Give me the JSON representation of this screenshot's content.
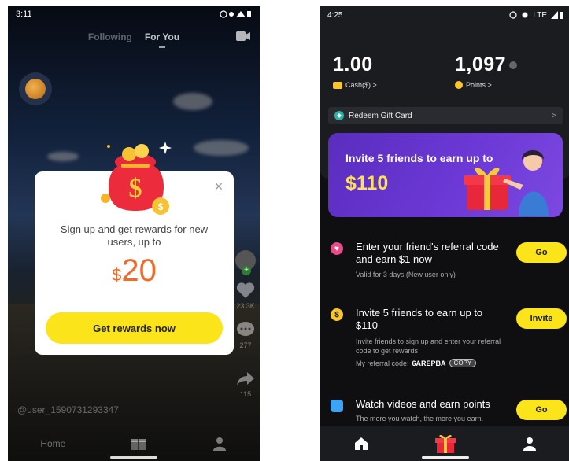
{
  "left": {
    "status": {
      "time": "3:11"
    },
    "tabs": {
      "following": "Following",
      "for_you": "For You"
    },
    "modal": {
      "text": "Sign up and get rewards for new users, up to",
      "currency": "$",
      "amount": "20",
      "cta": "Get rewards now"
    },
    "side": {
      "likes": "23.3K",
      "comments": "277",
      "shares": "115"
    },
    "username": "@user_1590731293347",
    "nav": {
      "home": "Home"
    }
  },
  "right": {
    "status": {
      "time": "4:25",
      "network": "LTE"
    },
    "cash": {
      "value": "1.00",
      "label": "Cash($) >"
    },
    "points": {
      "value": "1,097",
      "label": "Points >"
    },
    "redeem": {
      "label": "Redeem Gift Card",
      "chevron": ">"
    },
    "promo": {
      "line1": "Invite 5 friends to earn up to",
      "line2": "$110"
    },
    "tasks": [
      {
        "title": "Enter your friend's referral code and earn $1 now",
        "sub": "Valid for 3 days (New user only)",
        "button": "Go"
      },
      {
        "title": "Invite 5 friends to earn up to $110",
        "sub": "Invite friends to sign up and enter your referral code to get rewards",
        "code_label": "My referral code:",
        "code": "6AREPBA",
        "copy": "COPY",
        "button": "Invite"
      },
      {
        "title": "Watch videos and earn points",
        "sub": "The more you watch, the more you earn.",
        "button": "Go"
      }
    ],
    "colors": {
      "accent": "#fbe51a",
      "promo": "#6c38d6"
    }
  }
}
